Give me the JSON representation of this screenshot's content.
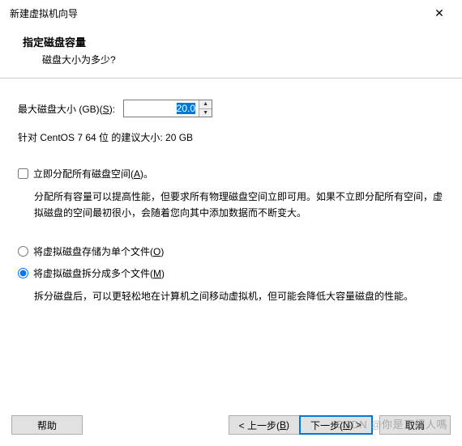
{
  "window": {
    "title": "新建虚拟机向导"
  },
  "header": {
    "title": "指定磁盘容量",
    "subtitle": "磁盘大小为多少?"
  },
  "disk": {
    "label_prefix": "最大磁盘大小 (GB)(",
    "label_hotkey": "S",
    "label_suffix": "):",
    "value": "20.0",
    "recommendation": "针对 CentOS 7 64 位 的建议大小: 20 GB"
  },
  "allocate": {
    "label_prefix": "立即分配所有磁盘空间(",
    "label_hotkey": "A",
    "label_suffix": ")。",
    "checked": false,
    "description": "分配所有容量可以提高性能，但要求所有物理磁盘空间立即可用。如果不立即分配所有空间，虚拟磁盘的空间最初很小，会随着您向其中添加数据而不断变大。"
  },
  "split": {
    "single_prefix": "将虚拟磁盘存储为单个文件(",
    "single_hotkey": "O",
    "single_suffix": ")",
    "multi_prefix": "将虚拟磁盘拆分成多个文件(",
    "multi_hotkey": "M",
    "multi_suffix": ")",
    "selected": "multi",
    "description": "拆分磁盘后，可以更轻松地在计算机之间移动虚拟机，但可能会降低大容量磁盘的性能。"
  },
  "buttons": {
    "help": "帮助",
    "back_prefix": "< 上一步(",
    "back_hotkey": "B",
    "back_suffix": ")",
    "next_prefix": "下一步(",
    "next_hotkey": "N",
    "next_suffix": ") >",
    "cancel": "取消"
  },
  "watermark": "CSDN @你是正經人嗎"
}
